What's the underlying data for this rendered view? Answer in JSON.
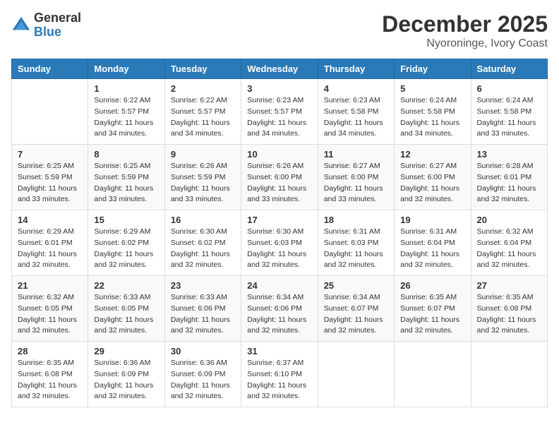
{
  "header": {
    "logo_general": "General",
    "logo_blue": "Blue",
    "month_title": "December 2025",
    "location": "Nyoroninge, Ivory Coast"
  },
  "days_of_week": [
    "Sunday",
    "Monday",
    "Tuesday",
    "Wednesday",
    "Thursday",
    "Friday",
    "Saturday"
  ],
  "weeks": [
    [
      {
        "day": "",
        "info": ""
      },
      {
        "day": "1",
        "info": "Sunrise: 6:22 AM\nSunset: 5:57 PM\nDaylight: 11 hours\nand 34 minutes."
      },
      {
        "day": "2",
        "info": "Sunrise: 6:22 AM\nSunset: 5:57 PM\nDaylight: 11 hours\nand 34 minutes."
      },
      {
        "day": "3",
        "info": "Sunrise: 6:23 AM\nSunset: 5:57 PM\nDaylight: 11 hours\nand 34 minutes."
      },
      {
        "day": "4",
        "info": "Sunrise: 6:23 AM\nSunset: 5:58 PM\nDaylight: 11 hours\nand 34 minutes."
      },
      {
        "day": "5",
        "info": "Sunrise: 6:24 AM\nSunset: 5:58 PM\nDaylight: 11 hours\nand 34 minutes."
      },
      {
        "day": "6",
        "info": "Sunrise: 6:24 AM\nSunset: 5:58 PM\nDaylight: 11 hours\nand 33 minutes."
      }
    ],
    [
      {
        "day": "7",
        "info": "Sunrise: 6:25 AM\nSunset: 5:59 PM\nDaylight: 11 hours\nand 33 minutes."
      },
      {
        "day": "8",
        "info": "Sunrise: 6:25 AM\nSunset: 5:59 PM\nDaylight: 11 hours\nand 33 minutes."
      },
      {
        "day": "9",
        "info": "Sunrise: 6:26 AM\nSunset: 5:59 PM\nDaylight: 11 hours\nand 33 minutes."
      },
      {
        "day": "10",
        "info": "Sunrise: 6:26 AM\nSunset: 6:00 PM\nDaylight: 11 hours\nand 33 minutes."
      },
      {
        "day": "11",
        "info": "Sunrise: 6:27 AM\nSunset: 6:00 PM\nDaylight: 11 hours\nand 33 minutes."
      },
      {
        "day": "12",
        "info": "Sunrise: 6:27 AM\nSunset: 6:00 PM\nDaylight: 11 hours\nand 32 minutes."
      },
      {
        "day": "13",
        "info": "Sunrise: 6:28 AM\nSunset: 6:01 PM\nDaylight: 11 hours\nand 32 minutes."
      }
    ],
    [
      {
        "day": "14",
        "info": "Sunrise: 6:29 AM\nSunset: 6:01 PM\nDaylight: 11 hours\nand 32 minutes."
      },
      {
        "day": "15",
        "info": "Sunrise: 6:29 AM\nSunset: 6:02 PM\nDaylight: 11 hours\nand 32 minutes."
      },
      {
        "day": "16",
        "info": "Sunrise: 6:30 AM\nSunset: 6:02 PM\nDaylight: 11 hours\nand 32 minutes."
      },
      {
        "day": "17",
        "info": "Sunrise: 6:30 AM\nSunset: 6:03 PM\nDaylight: 11 hours\nand 32 minutes."
      },
      {
        "day": "18",
        "info": "Sunrise: 6:31 AM\nSunset: 6:03 PM\nDaylight: 11 hours\nand 32 minutes."
      },
      {
        "day": "19",
        "info": "Sunrise: 6:31 AM\nSunset: 6:04 PM\nDaylight: 11 hours\nand 32 minutes."
      },
      {
        "day": "20",
        "info": "Sunrise: 6:32 AM\nSunset: 6:04 PM\nDaylight: 11 hours\nand 32 minutes."
      }
    ],
    [
      {
        "day": "21",
        "info": "Sunrise: 6:32 AM\nSunset: 6:05 PM\nDaylight: 11 hours\nand 32 minutes."
      },
      {
        "day": "22",
        "info": "Sunrise: 6:33 AM\nSunset: 6:05 PM\nDaylight: 11 hours\nand 32 minutes."
      },
      {
        "day": "23",
        "info": "Sunrise: 6:33 AM\nSunset: 6:06 PM\nDaylight: 11 hours\nand 32 minutes."
      },
      {
        "day": "24",
        "info": "Sunrise: 6:34 AM\nSunset: 6:06 PM\nDaylight: 11 hours\nand 32 minutes."
      },
      {
        "day": "25",
        "info": "Sunrise: 6:34 AM\nSunset: 6:07 PM\nDaylight: 11 hours\nand 32 minutes."
      },
      {
        "day": "26",
        "info": "Sunrise: 6:35 AM\nSunset: 6:07 PM\nDaylight: 11 hours\nand 32 minutes."
      },
      {
        "day": "27",
        "info": "Sunrise: 6:35 AM\nSunset: 6:08 PM\nDaylight: 11 hours\nand 32 minutes."
      }
    ],
    [
      {
        "day": "28",
        "info": "Sunrise: 6:35 AM\nSunset: 6:08 PM\nDaylight: 11 hours\nand 32 minutes."
      },
      {
        "day": "29",
        "info": "Sunrise: 6:36 AM\nSunset: 6:09 PM\nDaylight: 11 hours\nand 32 minutes."
      },
      {
        "day": "30",
        "info": "Sunrise: 6:36 AM\nSunset: 6:09 PM\nDaylight: 11 hours\nand 32 minutes."
      },
      {
        "day": "31",
        "info": "Sunrise: 6:37 AM\nSunset: 6:10 PM\nDaylight: 11 hours\nand 32 minutes."
      },
      {
        "day": "",
        "info": ""
      },
      {
        "day": "",
        "info": ""
      },
      {
        "day": "",
        "info": ""
      }
    ]
  ]
}
